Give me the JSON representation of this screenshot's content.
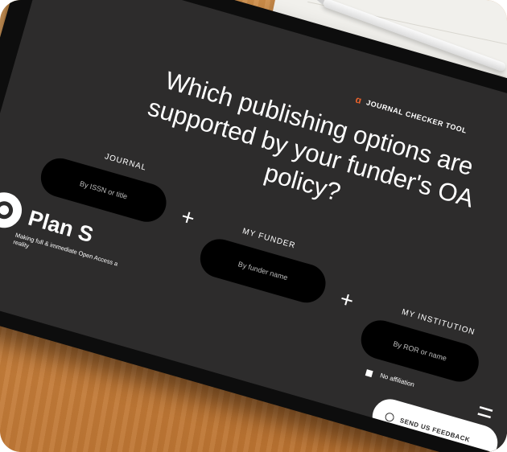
{
  "jct": {
    "icon": "open-access-icon",
    "label": "JOURNAL CHECKER TOOL"
  },
  "headline": "Which publishing options are supported by your funder's OA policy?",
  "fields": {
    "journal": {
      "label": "JOURNAL",
      "placeholder": "By ISSN or title"
    },
    "funder": {
      "label": "MY FUNDER",
      "placeholder": "By funder name"
    },
    "institution": {
      "label": "MY INSTITUTION",
      "placeholder": "By ROR or name"
    }
  },
  "operators": {
    "plus": "+",
    "equals": "="
  },
  "no_affiliation": "No affiliation",
  "feedback": {
    "icon": "chat-icon",
    "label": "SEND US FEEDBACK"
  },
  "plans": {
    "name": "Plan S",
    "tagline": "Making full & immediate Open Access a reality"
  },
  "colors": {
    "screen": "#2d2c2c",
    "accent": "#e8622c",
    "pill": "#000000",
    "table_wood": "#c9823f"
  }
}
